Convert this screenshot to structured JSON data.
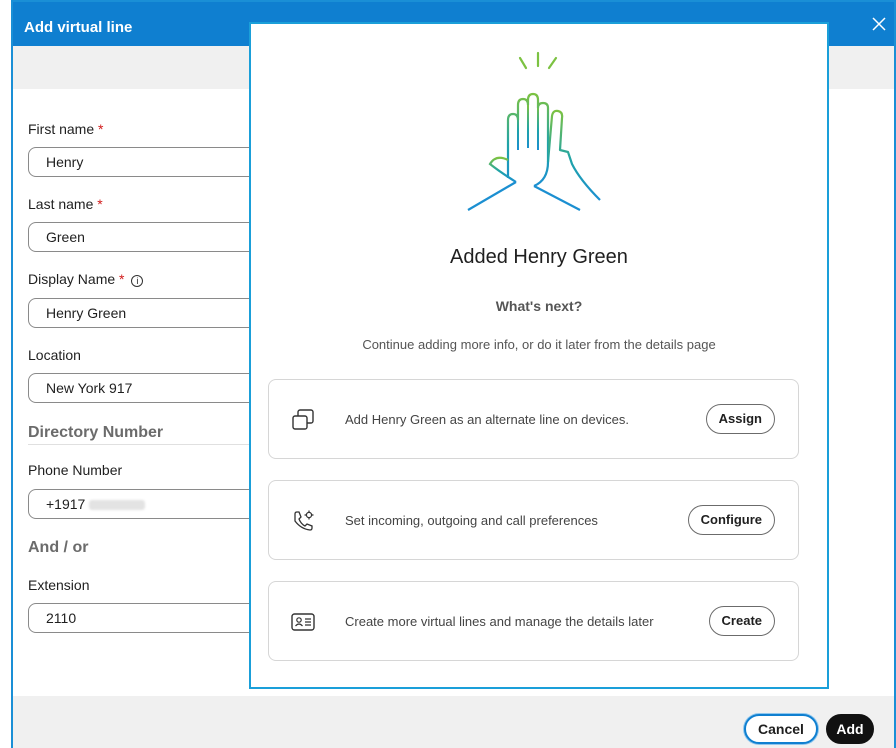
{
  "panel": {
    "title": "Add virtual line",
    "fields": {
      "first_name_label": "First name",
      "first_name_value": "Henry",
      "last_name_label": "Last name",
      "last_name_value": "Green",
      "display_name_label": "Display Name",
      "display_name_value": "Henry Green",
      "location_label": "Location",
      "location_value": "New York 917",
      "required_marker": "*",
      "info_glyph": "i"
    },
    "sections": {
      "directory_number": "Directory Number",
      "and_or": "And / or"
    },
    "phone": {
      "label": "Phone Number",
      "value": "+1917"
    },
    "extension": {
      "label": "Extension",
      "value": "2110"
    },
    "footer": {
      "cancel_label": "Cancel",
      "add_label": "Add"
    }
  },
  "modal": {
    "title": "Added Henry Green",
    "subtitle": "What's next?",
    "description": "Continue adding more info, or do it later from the details page",
    "cards": [
      {
        "icon": "devices-icon",
        "text": "Add Henry Green as an alternate line on devices.",
        "button": "Assign"
      },
      {
        "icon": "phone-settings-icon",
        "text": "Set incoming, outgoing and call preferences",
        "button": "Configure"
      },
      {
        "icon": "contact-card-icon",
        "text": "Create more virtual lines and manage the details later",
        "button": "Create"
      }
    ]
  },
  "colors": {
    "header_blue": "#0f7fd0",
    "modal_border": "#1a9fd9",
    "required_red": "#d11a1a",
    "hero_green": "#7cc242",
    "hero_teal": "#1fa3a8",
    "hero_blue": "#1b8fd1"
  }
}
